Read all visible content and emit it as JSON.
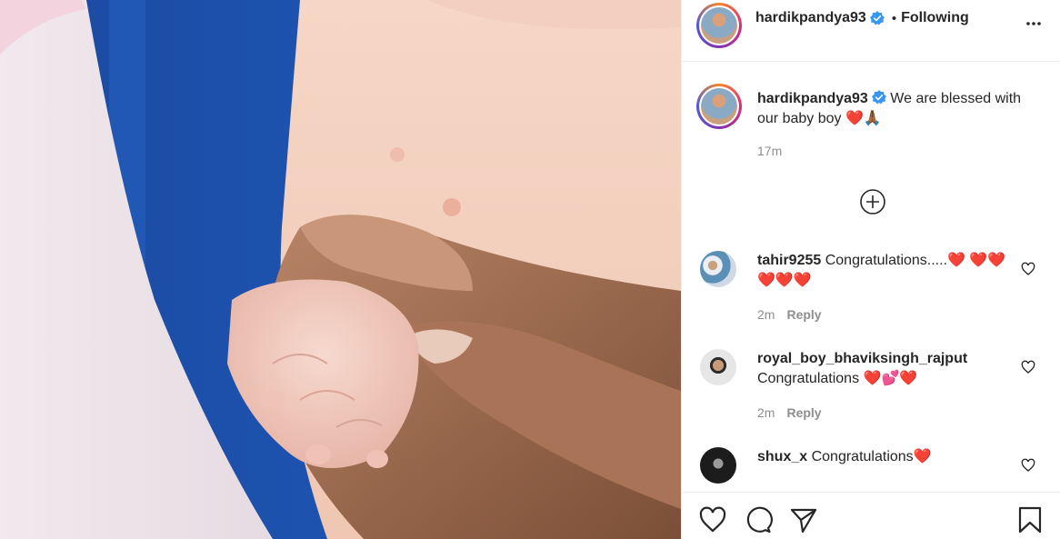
{
  "post": {
    "author": "hardikpandya93",
    "following_label": "Following",
    "separator": "•",
    "caption_text": "We are blessed with our baby boy ❤️🙏🏾",
    "time_ago": "17m"
  },
  "comments": [
    {
      "username": "tahir9255",
      "text": "Congratulations.....❤️ ❤️❤️❤️❤️❤️",
      "time": "2m",
      "reply_label": "Reply"
    },
    {
      "username": "royal_boy_bhaviksingh_rajput",
      "text": "Congratulations ❤️💕❤️",
      "time": "2m",
      "reply_label": "Reply"
    },
    {
      "username": "shux_x",
      "text": "Congratulations❤️",
      "time": "",
      "reply_label": ""
    }
  ],
  "icons": {
    "more": "more-options-icon",
    "verified": "verified-badge-icon",
    "add_comment": "add-circle-icon",
    "like": "heart-outline-icon",
    "comment": "comment-bubble-icon",
    "share": "paper-plane-icon",
    "save": "bookmark-icon"
  },
  "colors": {
    "verified_blue": "#3897f0",
    "meta_gray": "#8e8e8e",
    "heart_red": "#e0242f"
  }
}
